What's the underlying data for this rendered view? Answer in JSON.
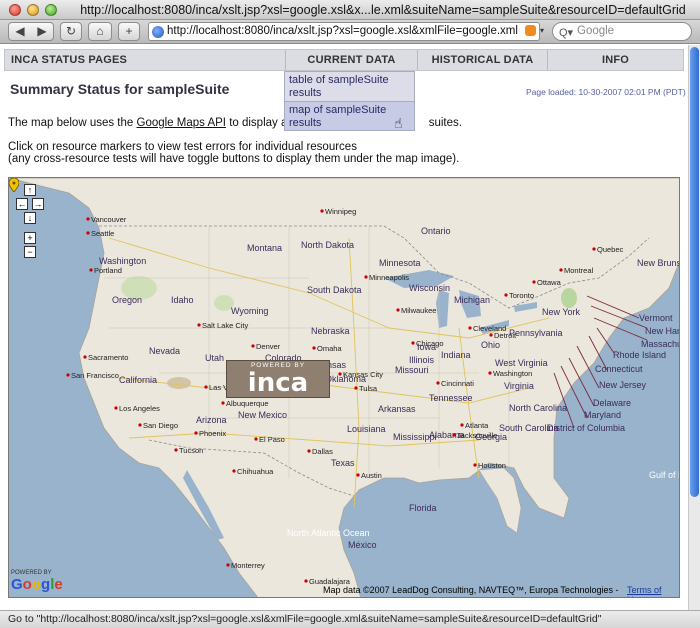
{
  "window": {
    "title": "http://localhost:8080/inca/xslt.jsp?xsl=google.xsl&x...le.xml&suiteName=sampleSuite&resourceID=defaultGrid"
  },
  "toolbar": {
    "back": "◀",
    "forward": "▶",
    "reload": "↻",
    "home": "⌂",
    "add": "+",
    "url": "http://localhost:8080/inca/xslt.jsp?xsl=google.xsl&xmlFile=google.xml",
    "search_placeholder": "Google"
  },
  "nav": {
    "home": "INCA STATUS PAGES",
    "current": "CURRENT DATA",
    "historical": "HISTORICAL DATA",
    "info": "INFO"
  },
  "dropdown": {
    "items": [
      "table of sampleSuite results",
      "map of sampleSuite results"
    ]
  },
  "page": {
    "title": "Summary Status for sampleSuite",
    "loaded": "Page loaded: 10-30-2007 02:01 PM (PDT)",
    "desc_prefix": "The map below uses the ",
    "desc_link": "Google Maps API",
    "desc_suffix": " to display a su",
    "desc_tail": "suites.",
    "note1": "Click on resource markers to view test errors for individual resources",
    "note2": "(any cross-resource tests will have toggle buttons to display them under the map image)."
  },
  "map": {
    "controls": {
      "up": "↑",
      "left": "←",
      "right": "→",
      "down": "↓",
      "zoom_in": "+",
      "zoom_out": "−"
    },
    "inca_logo_powered": "POWERED BY",
    "inca_logo_name": "inca",
    "google_powered": "POWERED BY",
    "google_name": "Google",
    "copyright": "Map data ©2007 LeadDog Consulting, NAVTEQ™, Europa Technologies -",
    "terms": "Terms of Use",
    "labels": [
      {
        "name": "Vancouver",
        "cls": "city"
      },
      {
        "name": "Seattle",
        "cls": "city"
      },
      {
        "name": "Washington",
        "cls": "state"
      },
      {
        "name": "Portland",
        "cls": "city"
      },
      {
        "name": "Montana",
        "cls": "state"
      },
      {
        "name": "North Dakota",
        "cls": "state"
      },
      {
        "name": "Winnipeg",
        "cls": "city"
      },
      {
        "name": "Ontario",
        "cls": "state"
      },
      {
        "name": "Quebec",
        "cls": "city"
      },
      {
        "name": "New Brunswick",
        "cls": "state"
      },
      {
        "name": "Minnesota",
        "cls": "state"
      },
      {
        "name": "Minneapolis",
        "cls": "city"
      },
      {
        "name": "Oregon",
        "cls": "state"
      },
      {
        "name": "Idaho",
        "cls": "state"
      },
      {
        "name": "Wyoming",
        "cls": "state"
      },
      {
        "name": "South Dakota",
        "cls": "state"
      },
      {
        "name": "Wisconsin",
        "cls": "state"
      },
      {
        "name": "Michigan",
        "cls": "state"
      },
      {
        "name": "Montreal",
        "cls": "city"
      },
      {
        "name": "Ottawa",
        "cls": "city"
      },
      {
        "name": "Toronto",
        "cls": "city"
      },
      {
        "name": "Vermont",
        "cls": "state"
      },
      {
        "name": "New Hamp",
        "cls": "state"
      },
      {
        "name": "Massachuset",
        "cls": "state"
      },
      {
        "name": "New York",
        "cls": "state"
      },
      {
        "name": "Rhode Island",
        "cls": "state"
      },
      {
        "name": "Connecticut",
        "cls": "state"
      },
      {
        "name": "New Jersey",
        "cls": "state"
      },
      {
        "name": "Delaware",
        "cls": "state"
      },
      {
        "name": "Maryland",
        "cls": "state"
      },
      {
        "name": "District of Columbia",
        "cls": "state"
      },
      {
        "name": "Salt Lake City",
        "cls": "city"
      },
      {
        "name": "Nebraska",
        "cls": "state"
      },
      {
        "name": "Omaha",
        "cls": "city"
      },
      {
        "name": "Iowa",
        "cls": "state"
      },
      {
        "name": "Chicago",
        "cls": "city"
      },
      {
        "name": "Milwaukee",
        "cls": "city"
      },
      {
        "name": "Detroit",
        "cls": "city"
      },
      {
        "name": "Cleveland",
        "cls": "city"
      },
      {
        "name": "Pennsylvania",
        "cls": "state"
      },
      {
        "name": "Ohio",
        "cls": "state"
      },
      {
        "name": "Indiana",
        "cls": "state"
      },
      {
        "name": "Illinois",
        "cls": "state"
      },
      {
        "name": "Denver",
        "cls": "city"
      },
      {
        "name": "Colorado",
        "cls": "state"
      },
      {
        "name": "Kansas",
        "cls": "state"
      },
      {
        "name": "Kansas City",
        "cls": "city"
      },
      {
        "name": "Missouri",
        "cls": "state"
      },
      {
        "name": "Nevada",
        "cls": "state"
      },
      {
        "name": "Utah",
        "cls": "state"
      },
      {
        "name": "Sacramento",
        "cls": "city"
      },
      {
        "name": "San Francisco",
        "cls": "city"
      },
      {
        "name": "California",
        "cls": "state"
      },
      {
        "name": "Las Vegas",
        "cls": "city"
      },
      {
        "name": "Los Angeles",
        "cls": "city"
      },
      {
        "name": "San Diego",
        "cls": "city"
      },
      {
        "name": "Arizona",
        "cls": "state"
      },
      {
        "name": "Phoenix",
        "cls": "city"
      },
      {
        "name": "Tucson",
        "cls": "city"
      },
      {
        "name": "Albuquerque",
        "cls": "city"
      },
      {
        "name": "New Mexico",
        "cls": "state"
      },
      {
        "name": "El Paso",
        "cls": "city"
      },
      {
        "name": "Chihuahua",
        "cls": "city"
      },
      {
        "name": "Oklahoma",
        "cls": "state"
      },
      {
        "name": "Tulsa",
        "cls": "city"
      },
      {
        "name": "Arkansas",
        "cls": "state"
      },
      {
        "name": "Tennessee",
        "cls": "state"
      },
      {
        "name": "Cincinnati",
        "cls": "city"
      },
      {
        "name": "Washington",
        "cls": "city"
      },
      {
        "name": "West Virginia",
        "cls": "state"
      },
      {
        "name": "Virginia",
        "cls": "state"
      },
      {
        "name": "North Carolina",
        "cls": "state"
      },
      {
        "name": "South Carolina",
        "cls": "state"
      },
      {
        "name": "Atlanta",
        "cls": "city"
      },
      {
        "name": "Alabama",
        "cls": "state"
      },
      {
        "name": "Georgia",
        "cls": "state"
      },
      {
        "name": "Mississippi",
        "cls": "state"
      },
      {
        "name": "Louisiana",
        "cls": "state"
      },
      {
        "name": "Dallas",
        "cls": "city"
      },
      {
        "name": "Texas",
        "cls": "state"
      },
      {
        "name": "Austin",
        "cls": "city"
      },
      {
        "name": "Houston",
        "cls": "city"
      },
      {
        "name": "Jacksonville",
        "cls": "city"
      },
      {
        "name": "Florida",
        "cls": "state"
      },
      {
        "name": "Gulf of Mexico",
        "cls": "water"
      },
      {
        "name": "North Atlantic Ocean",
        "cls": "water"
      },
      {
        "name": "México",
        "cls": "state"
      },
      {
        "name": "Monterrey",
        "cls": "city"
      },
      {
        "name": "Guadalajara",
        "cls": "city"
      },
      {
        "name": "Mexico",
        "cls": "city"
      }
    ]
  },
  "status": "Go to \"http://localhost:8080/inca/xslt.jsp?xsl=google.xsl&xmlFile=google.xml&suiteName=sampleSuite&resourceID=defaultGrid\"",
  "colors": {
    "nav_bg": "#dcdde3",
    "dropdown_bg": "#dcdde8",
    "title": "#334455",
    "land": "#ebe7dd",
    "water": "#99b3cc",
    "marker": "#cc0000"
  }
}
